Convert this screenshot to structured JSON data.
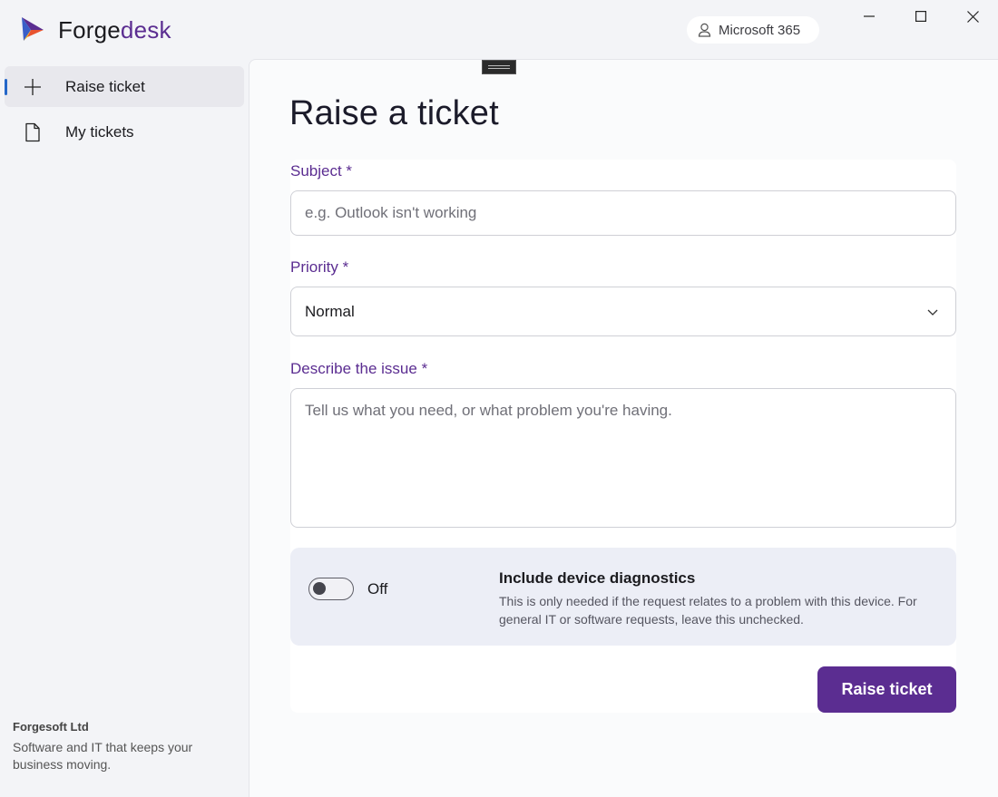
{
  "app": {
    "brand_part1": "Forge",
    "brand_part2": "desk",
    "account_label": "Microsoft 365",
    "accent_color": "#5b2d91"
  },
  "sidebar": {
    "items": [
      {
        "label": "Raise ticket",
        "icon": "plus-icon",
        "active": true
      },
      {
        "label": "My tickets",
        "icon": "document-icon",
        "active": false
      }
    ],
    "company_name": "Forgesoft Ltd",
    "company_tagline": "Software and IT that keeps your business moving."
  },
  "form": {
    "title": "Raise a ticket",
    "subject_label": "Subject *",
    "subject_placeholder": "e.g. Outlook isn't working",
    "subject_value": "",
    "priority_label": "Priority *",
    "priority_value": "Normal",
    "description_label": "Describe the issue *",
    "description_placeholder": "Tell us what you need, or what problem you're having.",
    "diagnostics_toggle_state": "Off",
    "diagnostics_title": "Include device diagnostics",
    "diagnostics_desc": "This is only needed if the request relates to a problem with this device. For general IT or software requests, leave this unchecked.",
    "submit_label": "Raise ticket"
  }
}
